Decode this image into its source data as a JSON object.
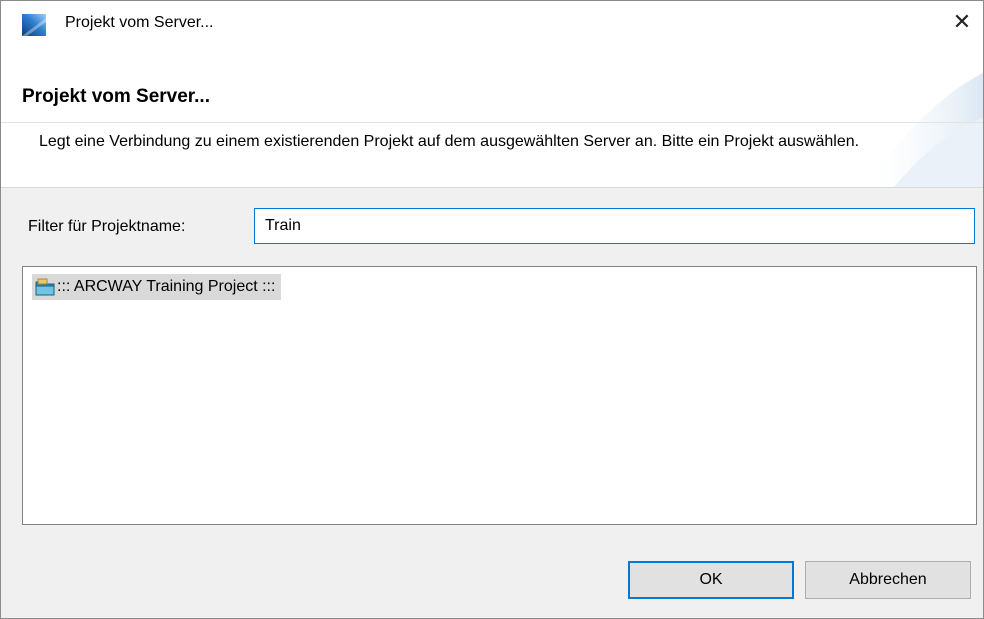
{
  "window": {
    "title": "Projekt vom Server...",
    "close_label": "✕"
  },
  "banner": {
    "title": "Projekt vom Server...",
    "description": "Legt eine Verbindung zu einem existierenden Projekt auf dem ausgewählten Server an. Bitte ein Projekt auswählen."
  },
  "filter": {
    "label": "Filter für Projektname:",
    "value": "Train"
  },
  "projects": [
    {
      "label": "::: ARCWAY Training Project :::",
      "icon": "folder-icon",
      "selected": true
    }
  ],
  "buttons": {
    "ok": "OK",
    "cancel": "Abbrechen"
  },
  "colors": {
    "accent": "#0078d7",
    "selection": "#d9d9d9",
    "dialog_bg": "#f0f0f0"
  }
}
